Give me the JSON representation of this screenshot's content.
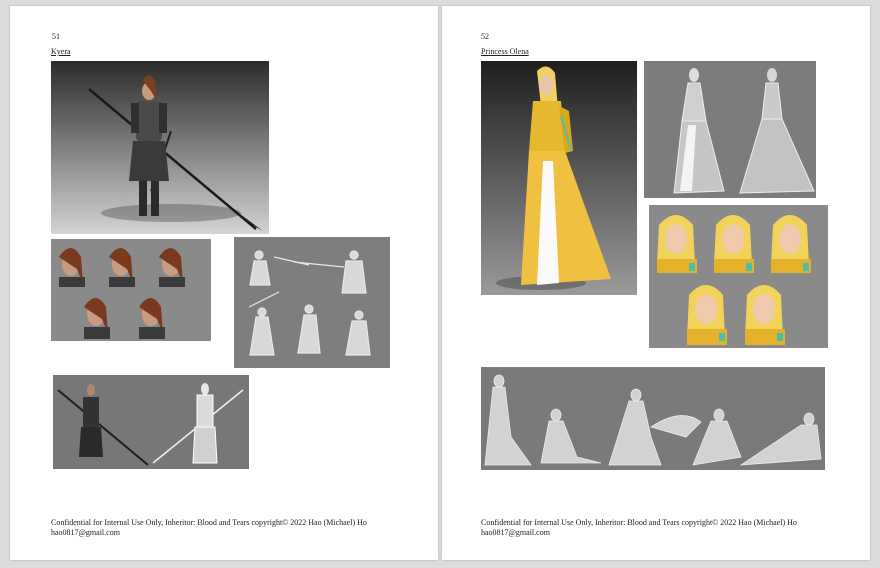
{
  "pages": [
    {
      "number": "51",
      "title": "Kyera",
      "images": [
        {
          "name": "kyera-full-body-render"
        },
        {
          "name": "kyera-face-expressions"
        },
        {
          "name": "kyera-combat-pose-sketches"
        },
        {
          "name": "kyera-turnaround"
        }
      ],
      "footer": {
        "line1": "Confidential for Internal Use Only, Inheritor: Blood and Tears copyright© 2022 Hao (Michael) Ho",
        "line2": "hao0817@gmail.com"
      }
    },
    {
      "number": "52",
      "title": "Princess Olena",
      "images": [
        {
          "name": "olena-full-body-render"
        },
        {
          "name": "olena-gown-sketches"
        },
        {
          "name": "olena-face-expressions"
        },
        {
          "name": "olena-pose-sketches"
        }
      ],
      "footer": {
        "line1": "Confidential for Internal Use Only, Inheritor: Blood and Tears copyright© 2022 Hao (Michael) Ho",
        "line2": "hao0817@gmail.com"
      }
    }
  ]
}
